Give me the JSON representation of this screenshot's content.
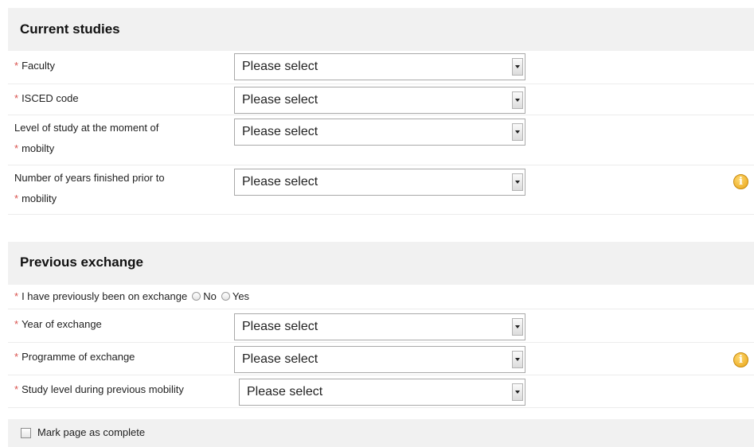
{
  "current_studies": {
    "title": "Current studies",
    "fields": [
      {
        "required_mark": "*",
        "label": "Faculty",
        "value": "Please select"
      },
      {
        "required_mark": "*",
        "label": "ISCED code",
        "value": "Please select"
      },
      {
        "label_line1": "Level of study at the moment of",
        "required_mark": "*",
        "label_line2": "mobilty",
        "value": "Please select"
      },
      {
        "label_line1": "Number of years finished prior to",
        "required_mark": "*",
        "label_line2": "mobility",
        "value": "Please select"
      }
    ],
    "info_icon": "i"
  },
  "previous_exchange": {
    "title": "Previous exchange",
    "radio_question": {
      "required_mark": "*",
      "label": "I have previously been on exchange",
      "options": [
        "No",
        "Yes"
      ]
    },
    "fields": [
      {
        "required_mark": "*",
        "label": "Year of exchange",
        "value": "Please select"
      },
      {
        "required_mark": "*",
        "label": "Programme of exchange",
        "value": "Please select"
      },
      {
        "required_mark": "*",
        "label": "Study level during previous mobility",
        "value": "Please select"
      }
    ],
    "info_icon": "i"
  },
  "footer": {
    "checkbox_label": "Mark page as complete"
  },
  "colors": {
    "required": "#d9534f",
    "info": "#e8a417",
    "section_bg": "#f1f1f1"
  }
}
